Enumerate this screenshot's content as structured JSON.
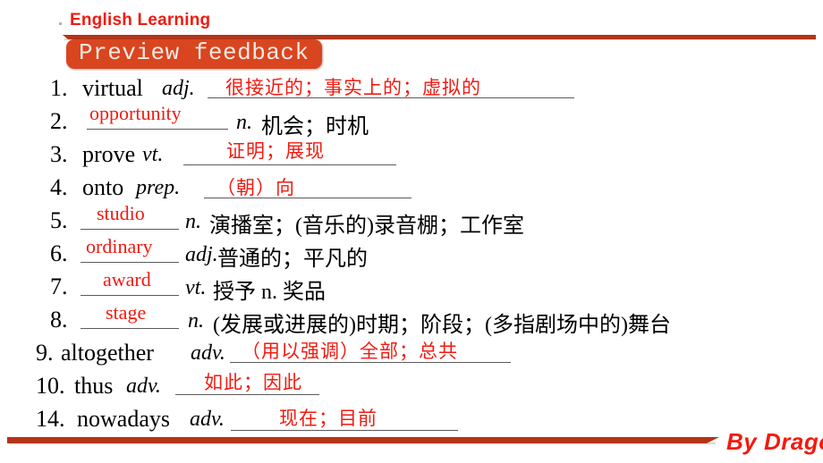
{
  "header": {
    "title": "English Learning",
    "banner_label": "Preview feedback",
    "accent_color": "#d9451f",
    "bar_color": "#b43418",
    "title_color": "#ee1c11"
  },
  "footer": {
    "byline": "By Dragon",
    "byline_color": "#f21a10"
  },
  "vocabulary": [
    {
      "num": "1.",
      "word": "virtual",
      "pos": "adj.",
      "answer": "很接近的；事实上的；虚拟的",
      "answer_type": "chinese",
      "gloss": ""
    },
    {
      "num": "2.",
      "word": "",
      "pos": "n.",
      "answer": "opportunity",
      "answer_type": "english",
      "gloss": "机会；时机"
    },
    {
      "num": "3.",
      "word": "prove",
      "pos": "vt.",
      "answer": "证明；展现",
      "answer_type": "chinese",
      "gloss": ""
    },
    {
      "num": "4.",
      "word": "onto",
      "pos": "prep.",
      "answer": "（朝）向",
      "answer_type": "chinese",
      "gloss": ""
    },
    {
      "num": "5.",
      "word": "",
      "pos": "n.",
      "answer": "studio",
      "answer_type": "english",
      "gloss": "演播室；(音乐的)录音棚；工作室"
    },
    {
      "num": "6.",
      "word": "",
      "pos": "adj.",
      "answer": "ordinary",
      "answer_type": "english",
      "gloss": "普通的；平凡的"
    },
    {
      "num": "7.",
      "word": "",
      "pos": "vt.",
      "answer": "award",
      "answer_type": "english",
      "gloss": "授予  n. 奖品"
    },
    {
      "num": "8.",
      "word": "",
      "pos": "n.",
      "answer": "stage",
      "answer_type": "english",
      "gloss": "(发展或进展的)时期；阶段；(多指剧场中的)舞台"
    },
    {
      "num": "9.",
      "word": "altogether",
      "pos": "adv.",
      "answer": "（用以强调）全部；总共",
      "answer_type": "chinese",
      "gloss": ""
    },
    {
      "num": "10.",
      "word": "thus",
      "pos": "adv.",
      "answer": "如此；因此",
      "answer_type": "chinese",
      "gloss": ""
    },
    {
      "num": "14.",
      "word": "nowadays",
      "pos": "adv.",
      "answer": "现在；目前",
      "answer_type": "chinese",
      "gloss": ""
    }
  ]
}
